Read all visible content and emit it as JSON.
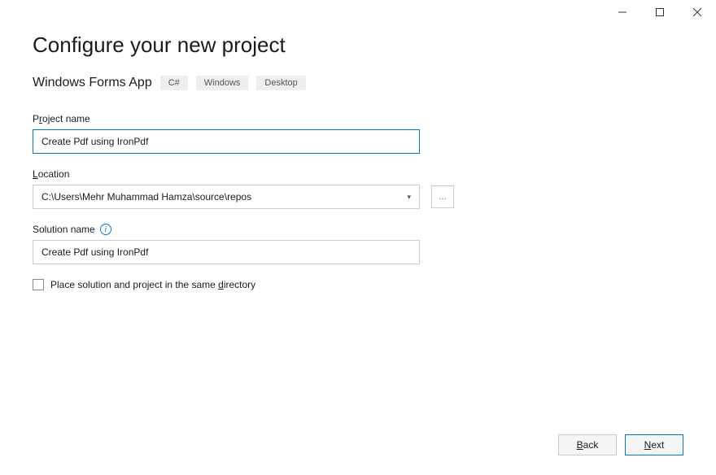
{
  "titlebar": {
    "minimize": "–",
    "maximize": "☐",
    "close": "✕"
  },
  "header": {
    "title": "Configure your new project",
    "subtitle": "Windows Forms App",
    "tags": [
      "C#",
      "Windows",
      "Desktop"
    ]
  },
  "fields": {
    "project_name": {
      "label_pre": "P",
      "label_underline": "r",
      "label_post": "oject name",
      "value": "Create Pdf using IronPdf"
    },
    "location": {
      "label_underline": "L",
      "label_post": "ocation",
      "value": "C:\\Users\\Mehr Muhammad Hamza\\source\\repos",
      "browse": "…"
    },
    "solution_name": {
      "label": "Solution name",
      "value": "Create Pdf using IronPdf"
    },
    "same_directory": {
      "label_pre": "Place solution and project in the same ",
      "label_underline": "d",
      "label_post": "irectory"
    }
  },
  "footer": {
    "back_underline": "B",
    "back_post": "ack",
    "next_underline": "N",
    "next_post": "ext"
  }
}
